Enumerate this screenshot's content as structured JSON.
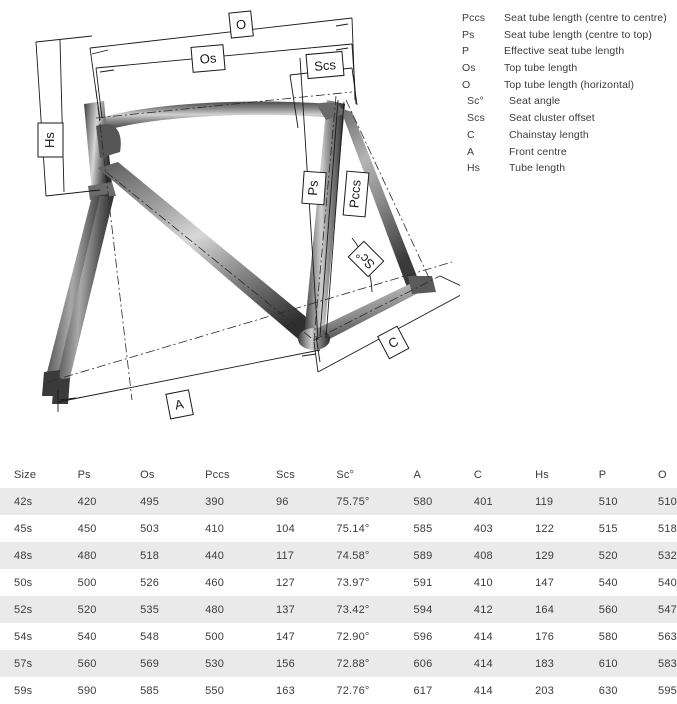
{
  "legend": {
    "items": [
      {
        "symbol": "Pccs",
        "description": "Seat tube length (centre to centre)",
        "indent": false
      },
      {
        "symbol": "Ps",
        "description": "Seat tube length (centre to top)",
        "indent": false
      },
      {
        "symbol": "P",
        "description": "Effective seat tube length",
        "indent": false
      },
      {
        "symbol": "Os",
        "description": "Top tube length",
        "indent": false
      },
      {
        "symbol": "O",
        "description": "Top tube length (horizontal)",
        "indent": false
      },
      {
        "symbol": "Sc°",
        "description": "Seat angle",
        "indent": true
      },
      {
        "symbol": "Scs",
        "description": "Seat cluster offset",
        "indent": true
      },
      {
        "symbol": "C",
        "description": "Chainstay length",
        "indent": true
      },
      {
        "symbol": "A",
        "description": "Front centre",
        "indent": true
      },
      {
        "symbol": "Hs",
        "description": "Tube length",
        "indent": true
      }
    ]
  },
  "diagram": {
    "labels": {
      "o": "O",
      "os": "Os",
      "scs": "Scs",
      "hs": "Hs",
      "ps": "Ps",
      "pccs": "Pccs",
      "sc": "Sc°",
      "c": "C",
      "a": "A"
    }
  },
  "table": {
    "headers": [
      "Size",
      "Ps",
      "Os",
      "Pccs",
      "Scs",
      "Sc°",
      "A",
      "C",
      "Hs",
      "P",
      "O"
    ],
    "rows": [
      [
        "42s",
        "420",
        "495",
        "390",
        "96",
        "75.75°",
        "580",
        "401",
        "119",
        "510",
        "510"
      ],
      [
        "45s",
        "450",
        "503",
        "410",
        "104",
        "75.14°",
        "585",
        "403",
        "122",
        "515",
        "518"
      ],
      [
        "48s",
        "480",
        "518",
        "440",
        "117",
        "74.58°",
        "589",
        "408",
        "129",
        "520",
        "532"
      ],
      [
        "50s",
        "500",
        "526",
        "460",
        "127",
        "73.97°",
        "591",
        "410",
        "147",
        "540",
        "540"
      ],
      [
        "52s",
        "520",
        "535",
        "480",
        "137",
        "73.42°",
        "594",
        "412",
        "164",
        "560",
        "547"
      ],
      [
        "54s",
        "540",
        "548",
        "500",
        "147",
        "72.90°",
        "596",
        "414",
        "176",
        "580",
        "563"
      ],
      [
        "57s",
        "560",
        "569",
        "530",
        "156",
        "72.88°",
        "606",
        "414",
        "183",
        "610",
        "583"
      ],
      [
        "59s",
        "590",
        "585",
        "550",
        "163",
        "72.76°",
        "617",
        "414",
        "203",
        "630",
        "595"
      ]
    ]
  },
  "colors": {
    "alt_row": "#eaeaea",
    "text": "#3b3b3b",
    "line": "#1a1a1a"
  }
}
